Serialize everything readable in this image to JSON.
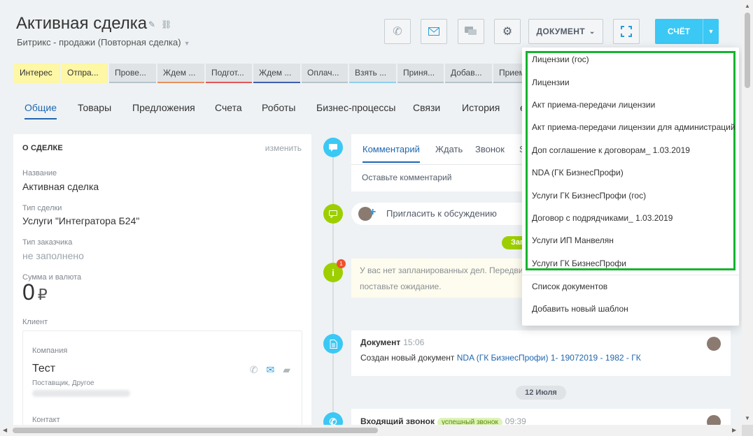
{
  "header": {
    "title": "Активная сделка",
    "subtitle": "Битрикс - продажи (Повторная сделка)",
    "document_label": "ДОКУМЕНТ",
    "invoice_label": "СЧЁТ"
  },
  "stages": [
    {
      "label": "Интерес",
      "status": "active",
      "bar": "#fdf7a6"
    },
    {
      "label": "Отпра...",
      "status": "active",
      "bar": "#fdf7a6"
    },
    {
      "label": "Прове...",
      "status": "inactive",
      "bar": "#b6c3cb"
    },
    {
      "label": "Ждем ...",
      "status": "inactive",
      "bar": "#e88f5c"
    },
    {
      "label": "Подгот...",
      "status": "inactive",
      "bar": "#e25858"
    },
    {
      "label": "Ждем ...",
      "status": "inactive",
      "bar": "#3c5fb0"
    },
    {
      "label": "Оплач...",
      "status": "inactive",
      "bar": "#b6c3cb"
    },
    {
      "label": "Взять ...",
      "status": "inactive",
      "bar": "#8ecff0"
    },
    {
      "label": "Приня...",
      "status": "inactive",
      "bar": "#b6c3cb"
    },
    {
      "label": "Добав...",
      "status": "inactive",
      "bar": "#b6c3cb"
    },
    {
      "label": "Прием",
      "status": "inactive",
      "bar": "#b6c3cb"
    }
  ],
  "tabs": [
    "Общие",
    "Товары",
    "Предложения",
    "Счета",
    "Роботы",
    "Бизнес-процессы",
    "Связи",
    "История",
    "е"
  ],
  "about": {
    "heading": "О СДЕЛКЕ",
    "edit": "изменить",
    "fields": [
      {
        "label": "Название",
        "value": "Активная сделка"
      },
      {
        "label": "Тип сделки",
        "value": "Услуги \"Интегратора Б24\""
      },
      {
        "label": "Тип заказчика",
        "value": "не заполнено"
      }
    ],
    "sum_label": "Сумма и валюта",
    "sum_value": "0",
    "currency": "₽",
    "client_label": "Клиент",
    "company_label": "Компания",
    "company_name": "Тест",
    "company_sub": "Поставщик, Другое",
    "contact_label": "Контакт"
  },
  "timeline": {
    "editor_tabs": [
      "Комментарий",
      "Ждать",
      "Звонок",
      "S"
    ],
    "comment_placeholder": "Оставьте комментарий",
    "invite": "Пригласить к обсуждению",
    "green_pill": "Запланировано",
    "badge": "1",
    "warning_line1": "У вас нет запланированных дел. Передвин",
    "warning_line2": "поставьте ожидание.",
    "doc_title": "Документ",
    "doc_time": "15:06",
    "doc_text": "Создан новый документ ",
    "doc_link": "NDA (ГК БизнесПрофи) 1- 19072019 - 1982 - ГК",
    "date_pill": "12 Июля",
    "call_title": "Входящий звонок",
    "call_status": "успешный звонок",
    "call_time": "09:39"
  },
  "dropdown": {
    "templates": [
      "Лицензии (гос)",
      "Лицензии",
      "Акт приема-передачи лицензии",
      "Акт приема-передачи лицензии для администраций",
      "Доп соглашение к договорам_ 1.03.2019",
      "NDA (ГК БизнесПрофи)",
      "Услуги ГК БизнесПрофи (гос)",
      "Договор с подрядчиками_ 1.03.2019",
      "Услуги ИП Манвелян",
      "Услуги ГК БизнесПрофи"
    ],
    "doc_list": "Список документов",
    "add_template": "Добавить новый шаблон"
  },
  "colors": {
    "accent": "#2067b0",
    "invoice": "#3bc8f5",
    "highlight": "#17b32f",
    "timeline_green": "#9dcf00",
    "timeline_blue": "#3bc8f5"
  }
}
